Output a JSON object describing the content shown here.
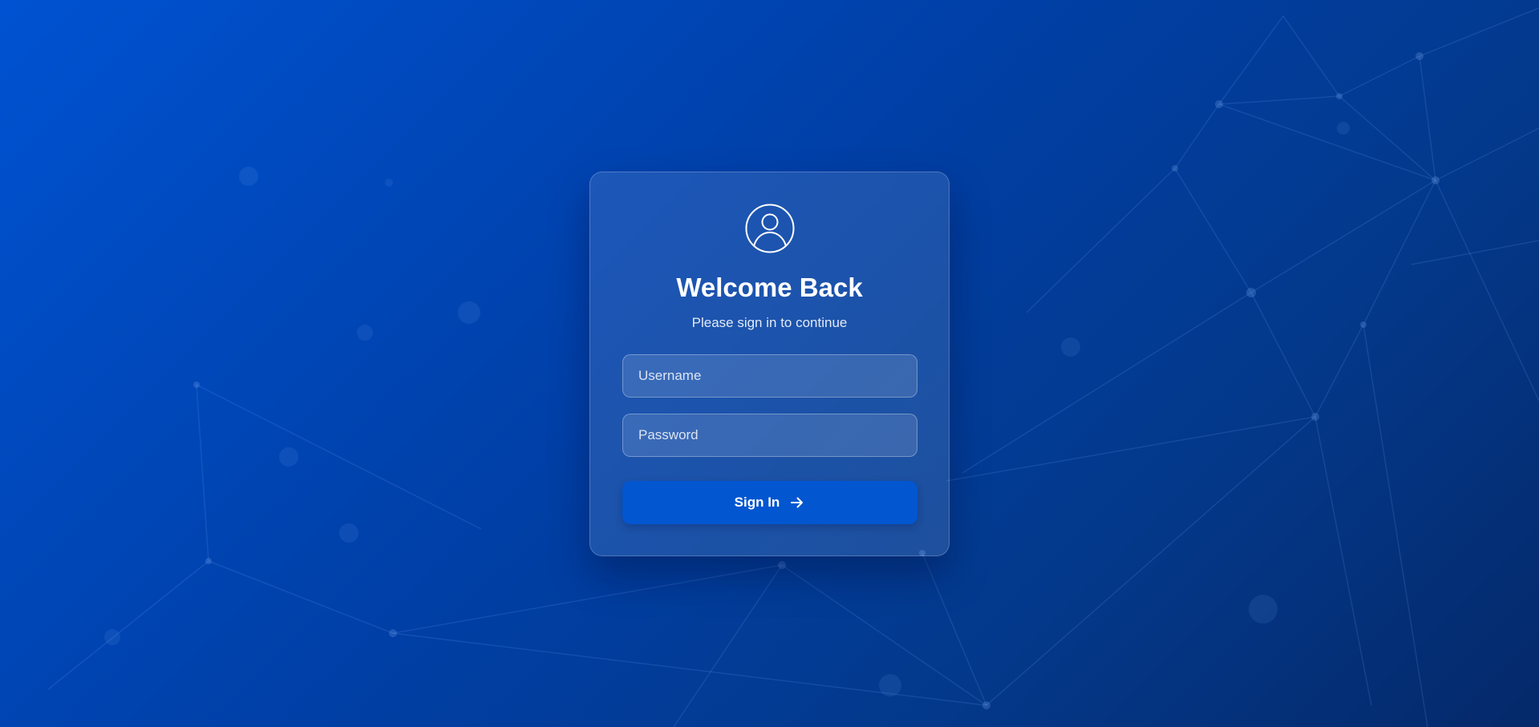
{
  "login": {
    "title": "Welcome Back",
    "subtitle": "Please sign in to continue",
    "username_placeholder": "Username",
    "username_value": "",
    "password_placeholder": "Password",
    "password_value": "",
    "signin_label": "Sign In"
  },
  "icons": {
    "avatar": "user-circle-icon",
    "signin": "arrow-right-icon"
  },
  "colors": {
    "background_start": "#0052d2",
    "background_end": "#05296a",
    "button": "#0256d0",
    "text": "#ffffff"
  }
}
